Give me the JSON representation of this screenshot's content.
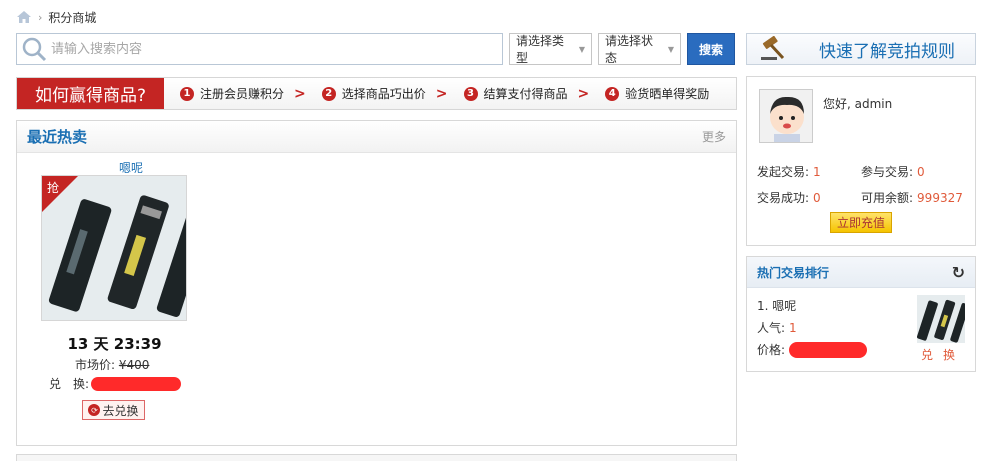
{
  "breadcrumb": {
    "current": "积分商城"
  },
  "search": {
    "placeholder": "请输入搜索内容",
    "type_select": "请选择类型",
    "status_select": "请选择状态",
    "button": "搜索"
  },
  "rules_button": "快速了解竞拍规则",
  "how_to_win": {
    "title": "如何赢得商品?",
    "steps": [
      {
        "num": "1",
        "label": "注册会员赚积分"
      },
      {
        "num": "2",
        "label": "选择商品巧出价"
      },
      {
        "num": "3",
        "label": "结算支付得商品"
      },
      {
        "num": "4",
        "label": "验货晒单得奖励"
      }
    ]
  },
  "recent": {
    "title": "最近热卖",
    "more": "更多",
    "product": {
      "name": "嗯呢",
      "badge": "抢",
      "countdown": "13 天 23:39",
      "market_price_label": "市场价: ",
      "market_price": "¥400",
      "exchange_label": "兑　换: ",
      "button": "去兑换"
    }
  },
  "user": {
    "greeting": "您好, admin",
    "stats": [
      {
        "label": "发起交易:",
        "value": "1"
      },
      {
        "label": "参与交易:",
        "value": "0"
      },
      {
        "label": "交易成功:",
        "value": "0"
      },
      {
        "label": "可用余额:",
        "value": "999327"
      }
    ],
    "recharge": "立即充值"
  },
  "hot": {
    "title": "热门交易排行",
    "item": {
      "rank_name": "1. 嗯呢",
      "pop_label": "人气:",
      "pop_value": "1",
      "price_label": "价格:",
      "exchange": "兑换"
    }
  },
  "colors": {
    "accent_blue": "#1a6fb3",
    "brand_red": "#c42523",
    "value_orange": "#e05a3a"
  }
}
